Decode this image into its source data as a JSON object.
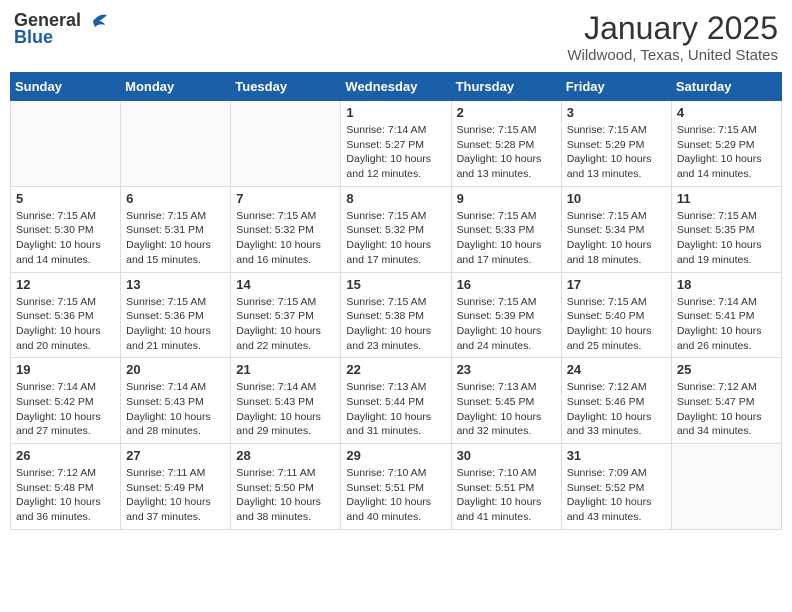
{
  "header": {
    "logo_general": "General",
    "logo_blue": "Blue",
    "month": "January 2025",
    "location": "Wildwood, Texas, United States"
  },
  "days_of_week": [
    "Sunday",
    "Monday",
    "Tuesday",
    "Wednesday",
    "Thursday",
    "Friday",
    "Saturday"
  ],
  "weeks": [
    [
      {
        "day": "",
        "info": ""
      },
      {
        "day": "",
        "info": ""
      },
      {
        "day": "",
        "info": ""
      },
      {
        "day": "1",
        "info": "Sunrise: 7:14 AM\nSunset: 5:27 PM\nDaylight: 10 hours\nand 12 minutes."
      },
      {
        "day": "2",
        "info": "Sunrise: 7:15 AM\nSunset: 5:28 PM\nDaylight: 10 hours\nand 13 minutes."
      },
      {
        "day": "3",
        "info": "Sunrise: 7:15 AM\nSunset: 5:29 PM\nDaylight: 10 hours\nand 13 minutes."
      },
      {
        "day": "4",
        "info": "Sunrise: 7:15 AM\nSunset: 5:29 PM\nDaylight: 10 hours\nand 14 minutes."
      }
    ],
    [
      {
        "day": "5",
        "info": "Sunrise: 7:15 AM\nSunset: 5:30 PM\nDaylight: 10 hours\nand 14 minutes."
      },
      {
        "day": "6",
        "info": "Sunrise: 7:15 AM\nSunset: 5:31 PM\nDaylight: 10 hours\nand 15 minutes."
      },
      {
        "day": "7",
        "info": "Sunrise: 7:15 AM\nSunset: 5:32 PM\nDaylight: 10 hours\nand 16 minutes."
      },
      {
        "day": "8",
        "info": "Sunrise: 7:15 AM\nSunset: 5:32 PM\nDaylight: 10 hours\nand 17 minutes."
      },
      {
        "day": "9",
        "info": "Sunrise: 7:15 AM\nSunset: 5:33 PM\nDaylight: 10 hours\nand 17 minutes."
      },
      {
        "day": "10",
        "info": "Sunrise: 7:15 AM\nSunset: 5:34 PM\nDaylight: 10 hours\nand 18 minutes."
      },
      {
        "day": "11",
        "info": "Sunrise: 7:15 AM\nSunset: 5:35 PM\nDaylight: 10 hours\nand 19 minutes."
      }
    ],
    [
      {
        "day": "12",
        "info": "Sunrise: 7:15 AM\nSunset: 5:36 PM\nDaylight: 10 hours\nand 20 minutes."
      },
      {
        "day": "13",
        "info": "Sunrise: 7:15 AM\nSunset: 5:36 PM\nDaylight: 10 hours\nand 21 minutes."
      },
      {
        "day": "14",
        "info": "Sunrise: 7:15 AM\nSunset: 5:37 PM\nDaylight: 10 hours\nand 22 minutes."
      },
      {
        "day": "15",
        "info": "Sunrise: 7:15 AM\nSunset: 5:38 PM\nDaylight: 10 hours\nand 23 minutes."
      },
      {
        "day": "16",
        "info": "Sunrise: 7:15 AM\nSunset: 5:39 PM\nDaylight: 10 hours\nand 24 minutes."
      },
      {
        "day": "17",
        "info": "Sunrise: 7:15 AM\nSunset: 5:40 PM\nDaylight: 10 hours\nand 25 minutes."
      },
      {
        "day": "18",
        "info": "Sunrise: 7:14 AM\nSunset: 5:41 PM\nDaylight: 10 hours\nand 26 minutes."
      }
    ],
    [
      {
        "day": "19",
        "info": "Sunrise: 7:14 AM\nSunset: 5:42 PM\nDaylight: 10 hours\nand 27 minutes."
      },
      {
        "day": "20",
        "info": "Sunrise: 7:14 AM\nSunset: 5:43 PM\nDaylight: 10 hours\nand 28 minutes."
      },
      {
        "day": "21",
        "info": "Sunrise: 7:14 AM\nSunset: 5:43 PM\nDaylight: 10 hours\nand 29 minutes."
      },
      {
        "day": "22",
        "info": "Sunrise: 7:13 AM\nSunset: 5:44 PM\nDaylight: 10 hours\nand 31 minutes."
      },
      {
        "day": "23",
        "info": "Sunrise: 7:13 AM\nSunset: 5:45 PM\nDaylight: 10 hours\nand 32 minutes."
      },
      {
        "day": "24",
        "info": "Sunrise: 7:12 AM\nSunset: 5:46 PM\nDaylight: 10 hours\nand 33 minutes."
      },
      {
        "day": "25",
        "info": "Sunrise: 7:12 AM\nSunset: 5:47 PM\nDaylight: 10 hours\nand 34 minutes."
      }
    ],
    [
      {
        "day": "26",
        "info": "Sunrise: 7:12 AM\nSunset: 5:48 PM\nDaylight: 10 hours\nand 36 minutes."
      },
      {
        "day": "27",
        "info": "Sunrise: 7:11 AM\nSunset: 5:49 PM\nDaylight: 10 hours\nand 37 minutes."
      },
      {
        "day": "28",
        "info": "Sunrise: 7:11 AM\nSunset: 5:50 PM\nDaylight: 10 hours\nand 38 minutes."
      },
      {
        "day": "29",
        "info": "Sunrise: 7:10 AM\nSunset: 5:51 PM\nDaylight: 10 hours\nand 40 minutes."
      },
      {
        "day": "30",
        "info": "Sunrise: 7:10 AM\nSunset: 5:51 PM\nDaylight: 10 hours\nand 41 minutes."
      },
      {
        "day": "31",
        "info": "Sunrise: 7:09 AM\nSunset: 5:52 PM\nDaylight: 10 hours\nand 43 minutes."
      },
      {
        "day": "",
        "info": ""
      }
    ]
  ]
}
